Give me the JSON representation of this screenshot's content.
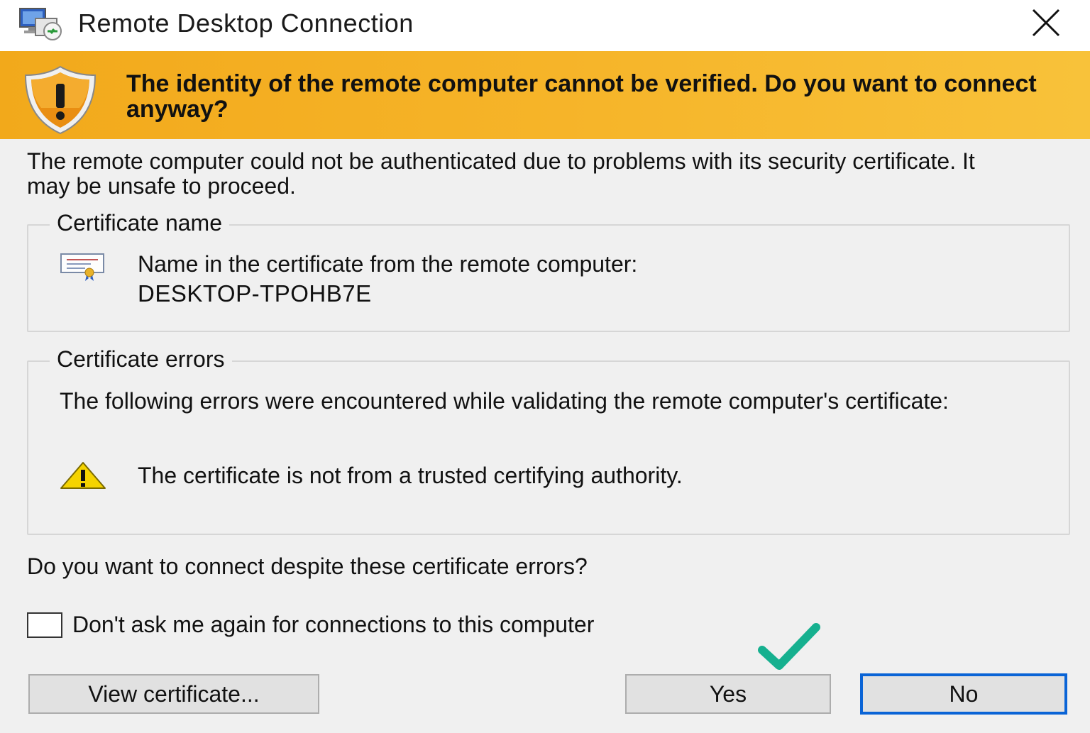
{
  "window": {
    "title": "Remote Desktop Connection"
  },
  "banner": {
    "text": "The identity of the remote computer cannot be verified. Do you want to connect anyway?",
    "color": "#f4b120"
  },
  "description": "The remote computer could not be authenticated due to problems with its security certificate. It may be unsafe to proceed.",
  "certificate_name": {
    "legend": "Certificate name",
    "label": "Name in the certificate from the remote computer:",
    "value": "DESKTOP-TPOHB7E"
  },
  "certificate_errors": {
    "legend": "Certificate errors",
    "intro": "The following errors were encountered while validating the remote computer's certificate:",
    "items": [
      "The certificate is not from a trusted certifying authority."
    ]
  },
  "question": "Do you want to connect despite these certificate errors?",
  "dont_ask_checkbox": {
    "label": "Don't ask me again for connections to this computer",
    "checked": false
  },
  "buttons": {
    "view_certificate": "View certificate...",
    "yes": "Yes",
    "no": "No"
  },
  "icons": {
    "app": "remote-desktop-icon",
    "close": "close-icon",
    "banner": "shield-warning-icon",
    "certificate": "certificate-icon",
    "error": "warning-triangle-icon",
    "annotation": "green-checkmark-icon"
  },
  "colors": {
    "focus_border": "#0a64d6",
    "checkmark": "#16b08f"
  }
}
